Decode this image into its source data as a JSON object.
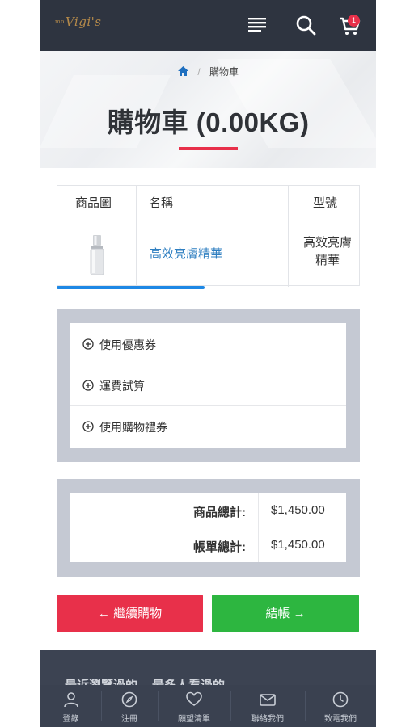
{
  "header": {
    "logo_prefix": "mo",
    "logo_text": "Vigi's",
    "cart_count": "1",
    "icons": {
      "menu": "menu-icon",
      "search": "search-icon",
      "cart": "cart-icon"
    }
  },
  "breadcrumb": {
    "home_icon": "home-icon",
    "separator": "/",
    "current": "購物車"
  },
  "page": {
    "title": "購物車 (0.00KG)"
  },
  "cart_table": {
    "headers": [
      "商品圖",
      "名稱",
      "型號"
    ],
    "rows": [
      {
        "image": "serum-bottle",
        "name": "高效亮膚精華",
        "model": "高效亮膚精華"
      }
    ]
  },
  "options": [
    {
      "label": "使用優惠券"
    },
    {
      "label": "運費試算"
    },
    {
      "label": "使用購物禮券"
    }
  ],
  "totals": [
    {
      "label": "商品總計:",
      "value": "$1,450.00"
    },
    {
      "label": "帳單總計:",
      "value": "$1,450.00"
    }
  ],
  "buttons": {
    "continue": "← 繼續購物",
    "checkout": "結帳 →"
  },
  "footer": {
    "recent_viewed": "最近瀏覽過的",
    "most_viewed": "最多人看過的"
  },
  "bottom_nav": [
    {
      "label": "登錄",
      "icon": "user-icon"
    },
    {
      "label": "注冊",
      "icon": "compass-icon"
    },
    {
      "label": "願望清單",
      "icon": "heart-icon"
    },
    {
      "label": "聯絡我們",
      "icon": "mail-icon"
    },
    {
      "label": "致電我們",
      "icon": "clock-icon"
    }
  ],
  "colors": {
    "header_bg": "#2e3440",
    "accent_red": "#e8304a",
    "accent_green": "#2db640",
    "link_blue": "#2f7fc1",
    "panel_gray": "#c5c9d3"
  }
}
